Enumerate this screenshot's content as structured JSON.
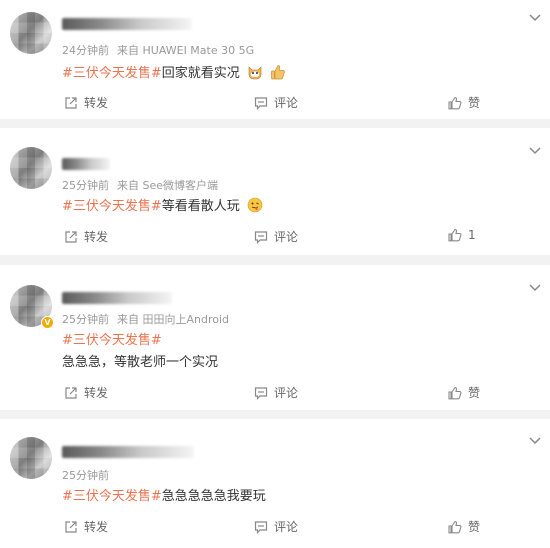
{
  "actions": {
    "repost": "转发",
    "comment": "评论",
    "like": "赞"
  },
  "posts": [
    {
      "time": "24分钟前",
      "source": "来自 HUAWEI Mate 30 5G",
      "hashtag": "#三伏今天发售#",
      "text": "回家就看实况",
      "emojis": [
        "cat-face-icon",
        "thumbs-up-icon"
      ],
      "like_count": "",
      "verified": false
    },
    {
      "time": "25分钟前",
      "source": "来自 See微博客户端",
      "hashtag": "#三伏今天发售#",
      "text": "等看看散人玩",
      "emojis": [
        "tongue-face-icon"
      ],
      "like_count": "1",
      "verified": false
    },
    {
      "time": "25分钟前",
      "source": "来自 田田向上Android",
      "hashtag": "#三伏今天发售#",
      "text": "急急急，等散老师一个实况",
      "emojis": [],
      "like_count": "",
      "verified": true
    },
    {
      "time": "25分钟前",
      "source": "",
      "hashtag": "#三伏今天发售#",
      "text": "急急急急急我要玩",
      "emojis": [],
      "like_count": "",
      "verified": false
    }
  ],
  "colors": {
    "hashtag": "#eb7350",
    "meta": "#999999",
    "background": "#f2f2f2",
    "verified_badge": "#f2a900"
  }
}
